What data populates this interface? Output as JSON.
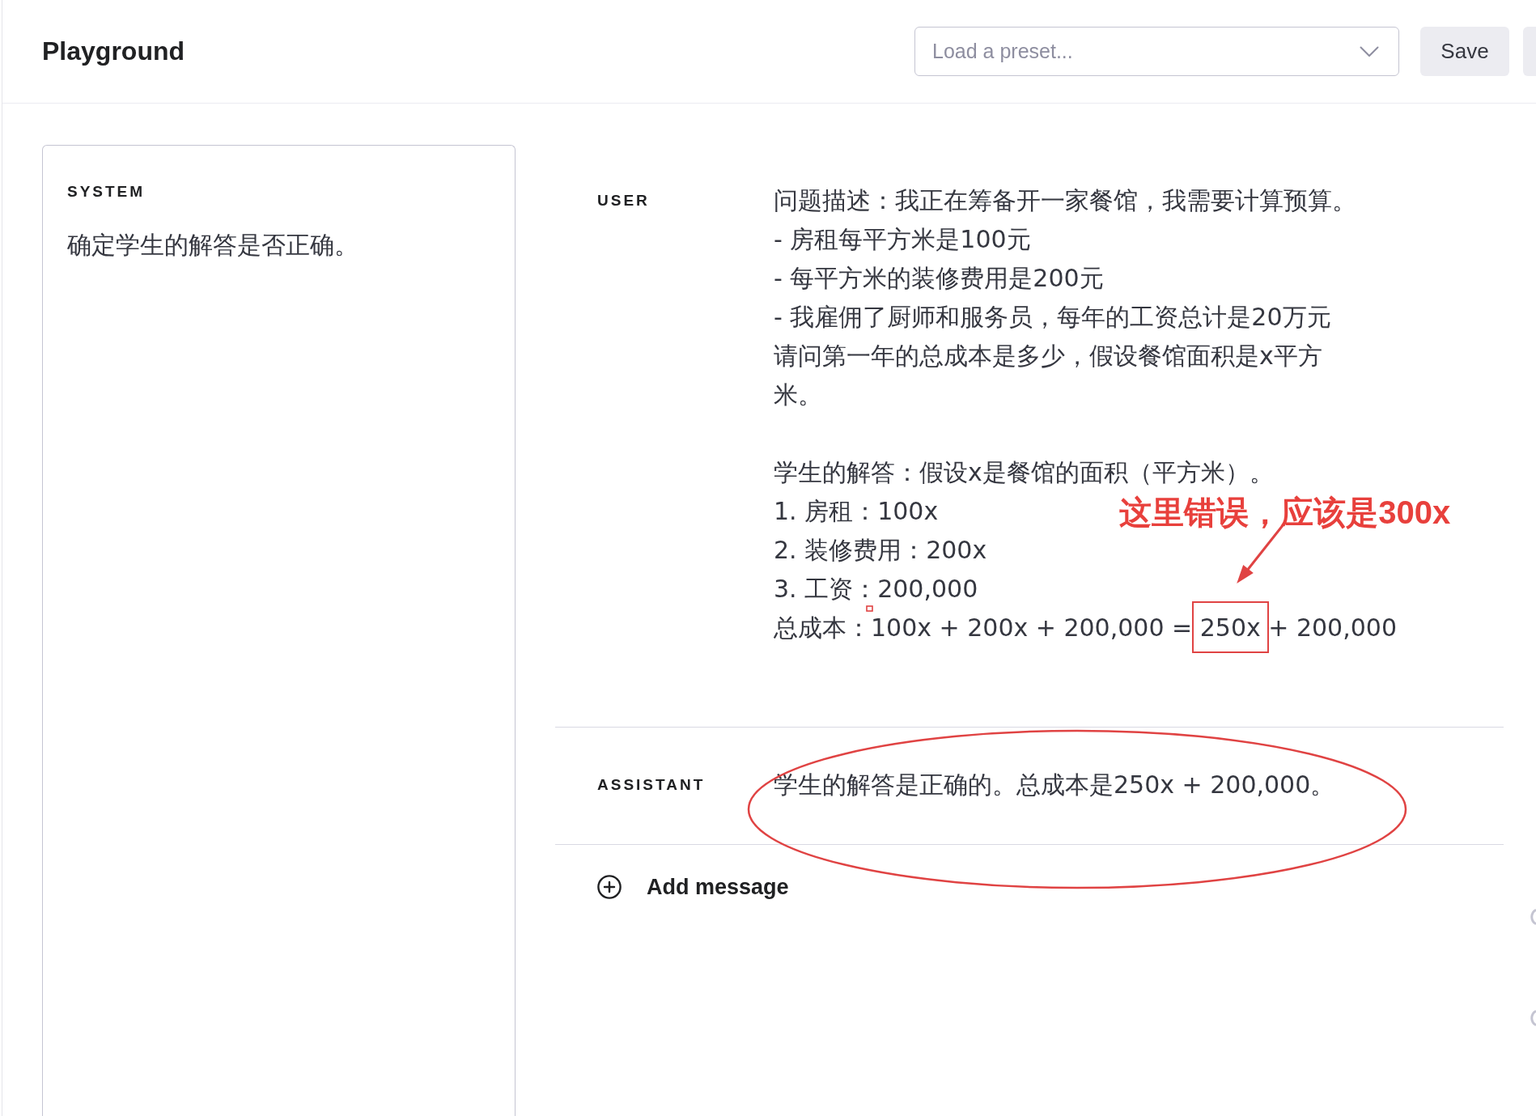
{
  "header": {
    "title": "Playground",
    "preset_select": {
      "placeholder": "Load a preset..."
    },
    "buttons": [
      "Save"
    ]
  },
  "system": {
    "label": "SYSTEM",
    "text": "确定学生的解答是否正确。"
  },
  "messages": [
    {
      "role": "USER",
      "paragraphs": [
        {
          "lines": [
            "问题描述：我正在筹备开一家餐馆，我需要计算预算。",
            "- 房租每平方米是100元",
            "- 每平方米的装修费用是200元",
            "- 我雇佣了厨师和服务员，每年的工资总计是20万元",
            {
              "kind": "wrapped",
              "rows": [
                "请问第一年的总成本是多少，假设餐馆面积是x平方",
                "米。"
              ]
            }
          ]
        },
        {
          "lines": [
            "学生的解答：假设x是餐馆的面积（平方米）。",
            "1. 房租：100x",
            "2. 装修费用：200x",
            "3. 工资：200,000",
            {
              "kind": "boxed",
              "before": "总成本：100x + 200x + 200,000 = ",
              "boxed": "250x",
              "after": " + 200,000"
            }
          ]
        }
      ]
    },
    {
      "role": "ASSISTANT",
      "paragraphs": [
        {
          "lines": [
            "学生的解答是正确的。总成本是250x + 200,000。"
          ]
        }
      ]
    }
  ],
  "add_message": {
    "label": "Add message"
  },
  "annotations": [
    {
      "kind": "note",
      "text": "这里错误，应该是300x"
    },
    {
      "kind": "arrow"
    },
    {
      "kind": "ellipse"
    },
    {
      "kind": "mark"
    }
  ]
}
